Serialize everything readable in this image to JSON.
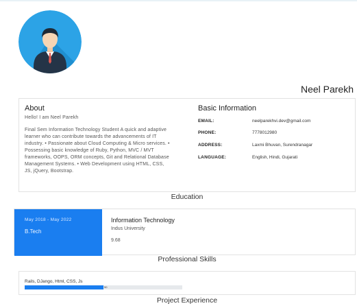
{
  "profile": {
    "name": "Neel Parekh",
    "avatar_icon": "user-avatar-icon",
    "avatar_color": "#2ca3e6"
  },
  "about": {
    "title": "About",
    "greeting": "Hello! I am Neel Parekh",
    "description": "Final Sem Information Technology Student A quick and adaptive learner who can contribute towards the advancements of IT industry. • Passionate about Cloud Computing & Micro services. • Possessing basic knowledge of Ruby, Python, MVC / MVT frameworks, OOPS, ORM concepts, Git and Relational Database Management Systems. • Web Development using HTML, CSS, JS, jQuery, Bootstrap."
  },
  "basic_info": {
    "title": "Basic Information",
    "rows": [
      {
        "label": "EMAIL:",
        "value": "neelparekhvi.dev@gmail.com"
      },
      {
        "label": "PHONE:",
        "value": "7778012980"
      },
      {
        "label": "ADDRESS:",
        "value": "Laxmi Bhuvan, Surendranagar"
      },
      {
        "label": "LANGUAGE:",
        "value": "English, Hindi, Gujarati"
      }
    ]
  },
  "education": {
    "title": "Education",
    "dates": "May 2018 - May 2022",
    "degree": "B.Tech",
    "course": "Information Technology",
    "university": "Indus University",
    "score": "9.68",
    "accent_color": "#1a7ef0"
  },
  "skills": {
    "title": "Professional Skills",
    "items": [
      {
        "label": "Rails, DJango, Html, CSS, Js",
        "percent": 50,
        "percent_label": "50"
      }
    ]
  },
  "projects": {
    "title": "Project Experience"
  }
}
